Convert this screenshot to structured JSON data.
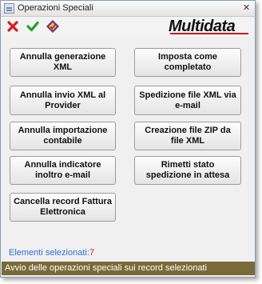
{
  "window": {
    "title": "Operazioni Speciali",
    "close_glyph": "✕"
  },
  "toolbar": {
    "icons": [
      "close-red-x-icon",
      "confirm-green-check-icon",
      "special-operations-icon"
    ],
    "colors": {
      "red_x": "#d71e1e",
      "green_check": "#1fa02c",
      "accent_purple": "#7a2d8f"
    }
  },
  "logo": {
    "text": "Multidata",
    "bar_color": "#c41b1b"
  },
  "buttons": {
    "annulla_generazione_xml": "Annulla generazione XML",
    "annulla_invio_xml": "Annulla invio XML al Provider",
    "annulla_importazione_contabile": "Annulla importazione contabile",
    "annulla_indicatore_inoltro": "Annulla indicatore inoltro e-mail",
    "cancella_record_fattura": "Cancella record Fattura Elettronica",
    "imposta_come_completato": "Imposta come completato",
    "spedizione_file_xml": "Spedizione file XML via e-mail",
    "creazione_file_zip": "Creazione file ZIP da file XML",
    "rimetti_stato_spedizione": "Rimetti stato spedizione in attesa"
  },
  "selection": {
    "label": "Elementi selezionati:",
    "count": "7"
  },
  "status": {
    "text": "Avvio delle operazioni speciali sui record selezionati",
    "bg_color": "#7a6a3a"
  }
}
